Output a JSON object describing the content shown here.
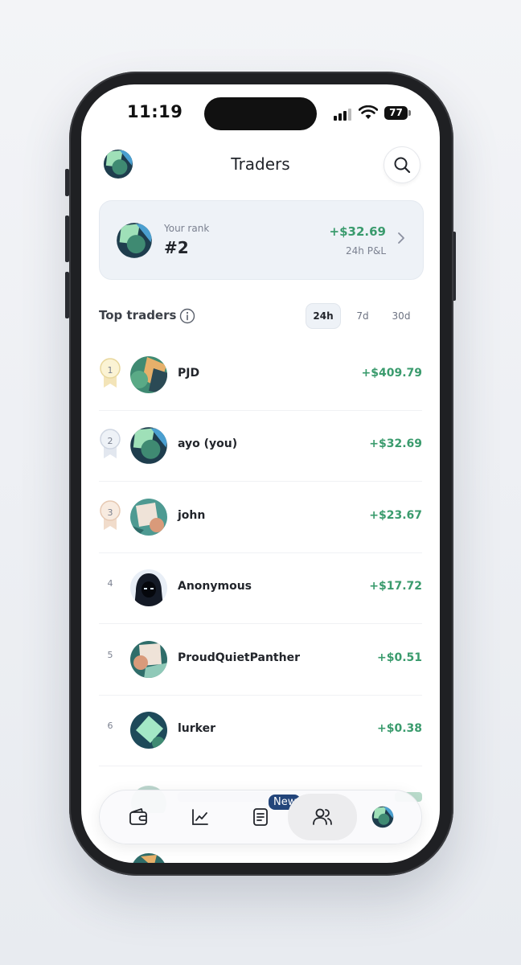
{
  "status_bar": {
    "time": "11:19",
    "battery": "77"
  },
  "header": {
    "title": "Traders",
    "search_icon": "search-icon",
    "avatar_icon": "profile-avatar"
  },
  "rank_card": {
    "label": "Your rank",
    "rank": "#2",
    "pnl": "+$32.69",
    "pnl_label": "24h P&L"
  },
  "top_traders": {
    "title": "Top traders",
    "periods": [
      "24h",
      "7d",
      "30d"
    ],
    "active_period": "24h",
    "rows": [
      {
        "rank": "1",
        "name": "PJD",
        "pnl": "+$409.79",
        "medal": "gold"
      },
      {
        "rank": "2",
        "name": "ayo (you)",
        "pnl": "+$32.69",
        "medal": "silver"
      },
      {
        "rank": "3",
        "name": "john",
        "pnl": "+$23.67",
        "medal": "bronze"
      },
      {
        "rank": "4",
        "name": "Anonymous",
        "pnl": "+$17.72",
        "medal": ""
      },
      {
        "rank": "5",
        "name": "ProudQuietPanther",
        "pnl": "+$0.51",
        "medal": ""
      },
      {
        "rank": "6",
        "name": "lurker",
        "pnl": "+$0.38",
        "medal": ""
      }
    ]
  },
  "tabbar": {
    "new_badge": "New",
    "tabs": [
      "wallet-icon",
      "chart-icon",
      "document-icon",
      "users-icon",
      "profile-avatar"
    ],
    "active": "users-icon"
  },
  "colors": {
    "positive": "#3a9b6d",
    "badge": "#23457a",
    "card_bg": "#eef2f7"
  }
}
